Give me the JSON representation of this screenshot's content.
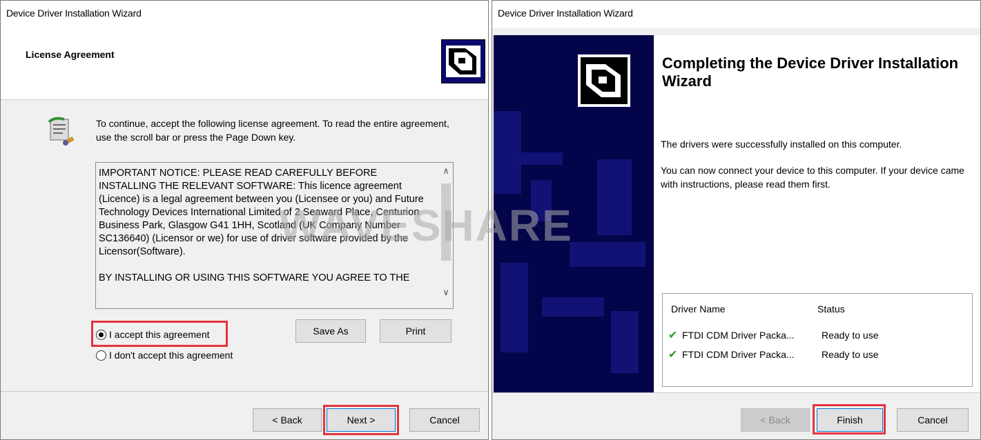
{
  "left": {
    "title": "Device Driver Installation Wizard",
    "header": "License Agreement",
    "intro": "To continue, accept the following license agreement. To read the entire agreement, use the scroll bar or press the Page Down key.",
    "license": {
      "p1": "IMPORTANT NOTICE: PLEASE READ CAREFULLY BEFORE INSTALLING THE RELEVANT SOFTWARE: This licence agreement (Licence) is a legal agreement between you (Licensee or you) and Future Technology Devices International Limited of 2 Seaward Place, Centurion Business Park, Glasgow G41 1HH, Scotland (UK Company Number SC136640) (Licensor or we) for use of driver software provided by the Licensor(Software).",
      "p2": "BY INSTALLING OR USING THIS SOFTWARE YOU AGREE TO THE"
    },
    "radio_accept": "I accept this agreement",
    "radio_decline": "I don't accept this agreement",
    "save_as": "Save As",
    "print": "Print",
    "back": "< Back",
    "next": "Next >",
    "cancel": "Cancel"
  },
  "right": {
    "title": "Device Driver Installation Wizard",
    "heading": "Completing the Device Driver Installation Wizard",
    "msg1": "The drivers were successfully installed on this computer.",
    "msg2": "You can now connect your device to this computer. If your device came with instructions, please read them first.",
    "table": {
      "col_name": "Driver Name",
      "col_status": "Status",
      "rows": [
        {
          "name": "FTDI CDM Driver Packa...",
          "status": "Ready to use"
        },
        {
          "name": "FTDI CDM Driver Packa...",
          "status": "Ready to use"
        }
      ]
    },
    "back": "< Back",
    "finish": "Finish",
    "cancel": "Cancel"
  },
  "watermark": "WAVESHARE",
  "colors": {
    "highlight": "#e5333e",
    "side_panel": "#04044a",
    "check": "#2a9a2a"
  }
}
